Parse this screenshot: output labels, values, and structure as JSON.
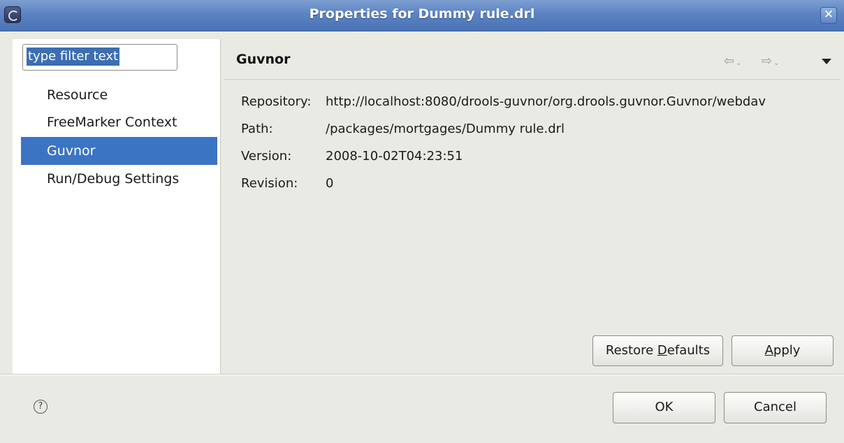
{
  "window": {
    "title": "Properties for Dummy rule.drl",
    "close_symbol": "✕",
    "icons": {
      "app": "eclipse-icon",
      "close": "close-icon"
    }
  },
  "sidebar": {
    "filter_placeholder": "type filter text",
    "filter_value": "type filter text",
    "items": [
      {
        "label": "Resource",
        "selected": false
      },
      {
        "label": "FreeMarker Context",
        "selected": false
      },
      {
        "label": "Guvnor",
        "selected": true
      },
      {
        "label": "Run/Debug Settings",
        "selected": false
      }
    ],
    "selection_color": "#3c74c4"
  },
  "page": {
    "title": "Guvnor",
    "nav": {
      "back_icon": "back-arrow-icon",
      "forward_icon": "forward-arrow-icon",
      "menu_icon": "view-menu-icon"
    },
    "properties": [
      {
        "label": "Repository:",
        "value": "http://localhost:8080/drools-guvnor/org.drools.guvnor.Guvnor/webdav"
      },
      {
        "label": "Path:",
        "value": "/packages/mortgages/Dummy rule.drl"
      },
      {
        "label": "Version:",
        "value": "2008-10-02T04:23:51"
      },
      {
        "label": "Revision:",
        "value": "0"
      }
    ],
    "buttons": {
      "restore_defaults_pre": "Restore ",
      "restore_defaults_mnemonic": "D",
      "restore_defaults_post": "efaults",
      "apply_mnemonic": "A",
      "apply_post": "pply"
    }
  },
  "footer": {
    "help_symbol": "?",
    "ok_label": "OK",
    "cancel_label": "Cancel"
  },
  "colors": {
    "titlebar": "#5c83c2",
    "dialog_bg": "#eaeae5"
  }
}
